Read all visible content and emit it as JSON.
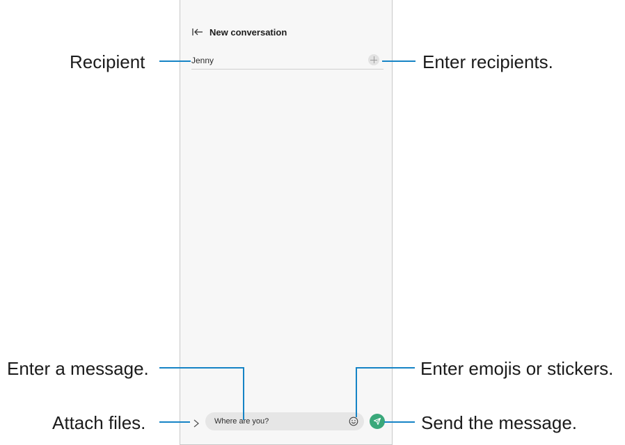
{
  "header": {
    "title": "New conversation",
    "back_icon": "back-to-start-icon"
  },
  "recipient": {
    "name": "Jenny",
    "add_icon": "plus-icon"
  },
  "composer": {
    "attach_icon": "chevron-right-icon",
    "message_text": "Where are you?",
    "emoji_icon": "smiley-icon",
    "send_icon": "send-icon"
  },
  "callouts": {
    "recipient": "Recipient",
    "enter_recipients": "Enter recipients.",
    "enter_message": "Enter a message.",
    "enter_emojis": "Enter emojis or stickers.",
    "attach_files": "Attach files.",
    "send_message": "Send the message."
  },
  "colors": {
    "callout_line": "#1583c5",
    "send_button": "#3aa87a",
    "phone_background": "#f7f7f7"
  }
}
